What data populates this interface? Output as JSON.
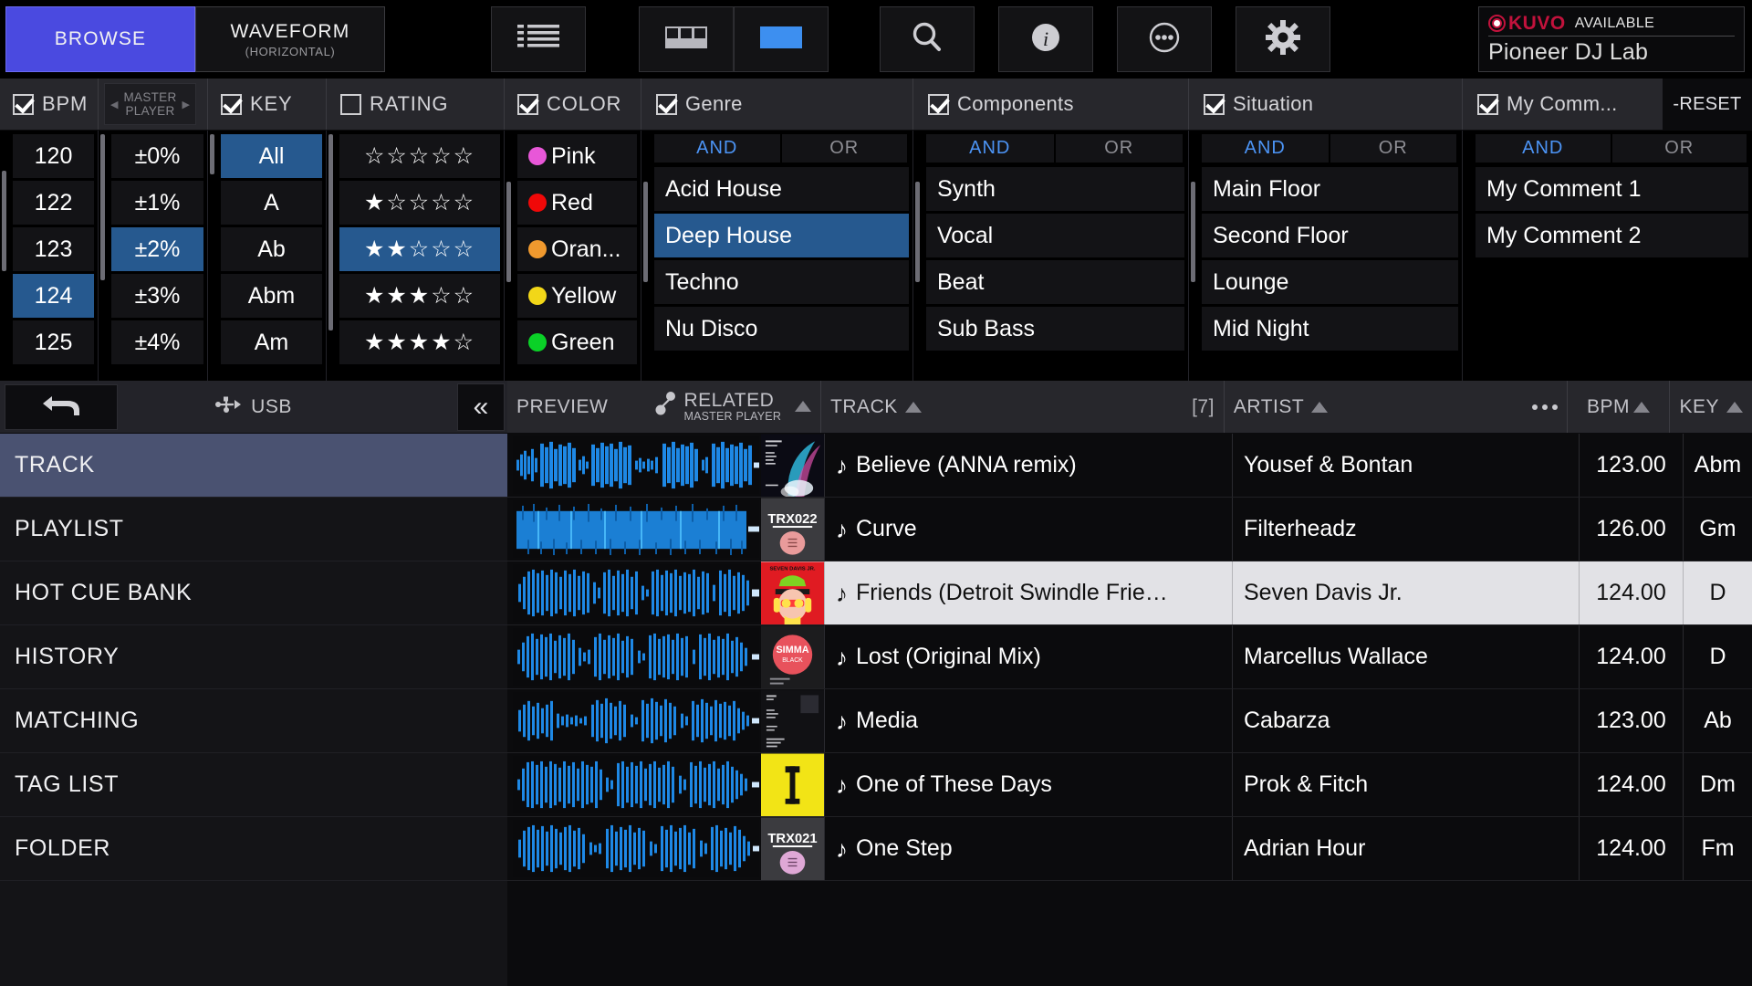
{
  "topbar": {
    "views": [
      {
        "main": "BROWSE",
        "sub": "",
        "active": true
      },
      {
        "main": "WAVEFORM",
        "sub": "(HORIZONTAL)",
        "active": false
      }
    ],
    "tools": [
      {
        "name": "list-view-icon",
        "active": false
      },
      {
        "name": "grid-layout-icon",
        "active": false
      },
      {
        "name": "split-layout-icon",
        "active": true
      },
      {
        "name": "search-icon",
        "active": false
      },
      {
        "name": "info-icon",
        "active": false
      },
      {
        "name": "more-icon",
        "active": false
      },
      {
        "name": "gear-icon",
        "active": false
      }
    ],
    "kuvo": {
      "brand": "KUVO",
      "status": "AVAILABLE",
      "venue": "Pioneer DJ Lab",
      "brand_color": "#c2123c"
    }
  },
  "filters": {
    "reset_label": "-RESET",
    "master_player": {
      "line1": "MASTER",
      "line2": "PLAYER",
      "left_arrow": "◀",
      "right_arrow": "▶"
    },
    "logic": {
      "and": "AND",
      "or": "OR"
    },
    "columns": [
      {
        "key": "bpm",
        "label": "BPM",
        "checked": true,
        "type": "plain",
        "items": [
          {
            "label": "120",
            "selected": false
          },
          {
            "label": "122",
            "selected": false
          },
          {
            "label": "123",
            "selected": false
          },
          {
            "label": "124",
            "selected": true
          },
          {
            "label": "125",
            "selected": false
          }
        ]
      },
      {
        "key": "tempo",
        "label": "",
        "checked": null,
        "type": "plain",
        "items": [
          {
            "label": "±0%",
            "selected": false
          },
          {
            "label": "±1%",
            "selected": false
          },
          {
            "label": "±2%",
            "selected": true
          },
          {
            "label": "±3%",
            "selected": false
          },
          {
            "label": "±4%",
            "selected": false
          }
        ]
      },
      {
        "key": "key",
        "label": "KEY",
        "checked": true,
        "type": "plain",
        "items": [
          {
            "label": "All",
            "selected": true
          },
          {
            "label": "A",
            "selected": false
          },
          {
            "label": "Ab",
            "selected": false
          },
          {
            "label": "Abm",
            "selected": false
          },
          {
            "label": "Am",
            "selected": false
          }
        ]
      },
      {
        "key": "rating",
        "label": "RATING",
        "checked": false,
        "type": "stars",
        "items": [
          {
            "label": "☆☆☆☆☆",
            "stars": 0,
            "selected": false
          },
          {
            "label": "★☆☆☆☆",
            "stars": 1,
            "selected": false
          },
          {
            "label": "★★☆☆☆",
            "stars": 2,
            "selected": true
          },
          {
            "label": "★★★☆☆",
            "stars": 3,
            "selected": false
          },
          {
            "label": "★★★★☆",
            "stars": 4,
            "selected": false
          }
        ]
      },
      {
        "key": "color",
        "label": "COLOR",
        "checked": true,
        "type": "color",
        "items": [
          {
            "label": "Pink",
            "color": "#e857d8",
            "selected": false
          },
          {
            "label": "Red",
            "color": "#f00808",
            "selected": false
          },
          {
            "label": "Oran...",
            "color": "#f0992e",
            "selected": false
          },
          {
            "label": "Yellow",
            "color": "#f2d718",
            "selected": false
          },
          {
            "label": "Green",
            "color": "#0ad127",
            "selected": false
          }
        ]
      },
      {
        "key": "genre",
        "label": "Genre",
        "checked": true,
        "type": "logic",
        "logic_selected": "AND",
        "items": [
          {
            "label": "Acid House",
            "selected": false
          },
          {
            "label": "Deep House",
            "selected": true
          },
          {
            "label": "Techno",
            "selected": false
          },
          {
            "label": "Nu Disco",
            "selected": false
          }
        ]
      },
      {
        "key": "components",
        "label": "Components",
        "checked": true,
        "type": "logic",
        "logic_selected": "AND",
        "items": [
          {
            "label": "Synth",
            "selected": false
          },
          {
            "label": "Vocal",
            "selected": false
          },
          {
            "label": "Beat",
            "selected": false
          },
          {
            "label": "Sub Bass",
            "selected": false
          }
        ]
      },
      {
        "key": "situation",
        "label": "Situation",
        "checked": true,
        "type": "logic",
        "logic_selected": "AND",
        "items": [
          {
            "label": "Main Floor",
            "selected": false
          },
          {
            "label": "Second Floor",
            "selected": false
          },
          {
            "label": "Lounge",
            "selected": false
          },
          {
            "label": "Mid Night",
            "selected": false
          }
        ]
      },
      {
        "key": "mycomment",
        "label": "My Comm...",
        "checked": true,
        "type": "logic",
        "logic_selected": "AND",
        "items": [
          {
            "label": "My Comment 1",
            "selected": false
          },
          {
            "label": "My Comment 2",
            "selected": false
          }
        ]
      }
    ]
  },
  "sidebar": {
    "device_label": "USB",
    "collapse_glyph": "«",
    "items": [
      {
        "label": "TRACK",
        "selected": true
      },
      {
        "label": "PLAYLIST",
        "selected": false
      },
      {
        "label": "HOT CUE BANK",
        "selected": false
      },
      {
        "label": "HISTORY",
        "selected": false
      },
      {
        "label": "MATCHING",
        "selected": false
      },
      {
        "label": "TAG LIST",
        "selected": false
      },
      {
        "label": "FOLDER",
        "selected": false
      }
    ]
  },
  "tracklist": {
    "headers": {
      "preview": "PREVIEW",
      "related": "RELATED",
      "related_sub": "MASTER PLAYER",
      "track": "TRACK",
      "count": "[7]",
      "artist": "ARTIST",
      "bpm": "BPM",
      "key": "KEY"
    },
    "rows": [
      {
        "title": "Believe (ANNA remix)",
        "artist": "Yousef & Bontan",
        "bpm": "123.00",
        "key": "Abm",
        "selected": false,
        "art": "believe"
      },
      {
        "title": "Curve",
        "artist": "Filterheadz",
        "bpm": "126.00",
        "key": "Gm",
        "selected": false,
        "art": "trx022"
      },
      {
        "title": "Friends (Detroit Swindle Frie…",
        "artist": "Seven Davis Jr.",
        "bpm": "124.00",
        "key": "D",
        "selected": true,
        "art": "friends"
      },
      {
        "title": "Lost (Original Mix)",
        "artist": "Marcellus Wallace",
        "bpm": "124.00",
        "key": "D",
        "selected": false,
        "art": "simma"
      },
      {
        "title": "Media",
        "artist": "Cabarza",
        "bpm": "123.00",
        "key": "Ab",
        "selected": false,
        "art": "media"
      },
      {
        "title": "One of These Days",
        "artist": "Prok & Fitch",
        "bpm": "124.00",
        "key": "Dm",
        "selected": false,
        "art": "days"
      },
      {
        "title": "One Step",
        "artist": "Adrian Hour",
        "bpm": "124.00",
        "key": "Fm",
        "selected": false,
        "art": "trx021"
      }
    ],
    "note_glyph": "♪"
  },
  "colors": {
    "accent_blue": "#4a4ae0",
    "selection_blue": "#26598f",
    "sidebar_selection": "#4a5271",
    "waveform_blue": "#2196f3"
  }
}
